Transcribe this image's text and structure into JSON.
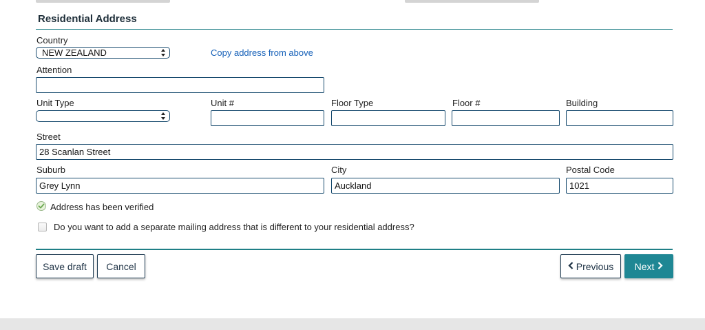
{
  "section": {
    "title": "Residential Address"
  },
  "country": {
    "label": "Country",
    "value": "NEW ZEALAND"
  },
  "copy_link": "Copy address from above",
  "attention": {
    "label": "Attention",
    "value": ""
  },
  "unit_type": {
    "label": "Unit Type",
    "value": ""
  },
  "unit_number": {
    "label": "Unit #",
    "value": ""
  },
  "floor_type": {
    "label": "Floor Type",
    "value": ""
  },
  "floor_number": {
    "label": "Floor #",
    "value": ""
  },
  "building": {
    "label": "Building",
    "value": ""
  },
  "street": {
    "label": "Street",
    "value": "28 Scanlan Street"
  },
  "suburb": {
    "label": "Suburb",
    "value": "Grey Lynn"
  },
  "city": {
    "label": "City",
    "value": "Auckland"
  },
  "postal_code": {
    "label": "Postal Code",
    "value": "1021"
  },
  "verified": {
    "text": "Address has been verified",
    "icon": "check-circle-icon",
    "color": "#6aa84f"
  },
  "mailing": {
    "question": "Do you want to add a separate mailing address that is different to your residential address?",
    "checked": false
  },
  "buttons": {
    "save_draft": "Save draft",
    "cancel": "Cancel",
    "previous": "Previous",
    "next": "Next"
  },
  "colors": {
    "accent": "#1f8794",
    "rule": "#1f7f86",
    "link": "#1560b8",
    "border": "#174a6e"
  }
}
